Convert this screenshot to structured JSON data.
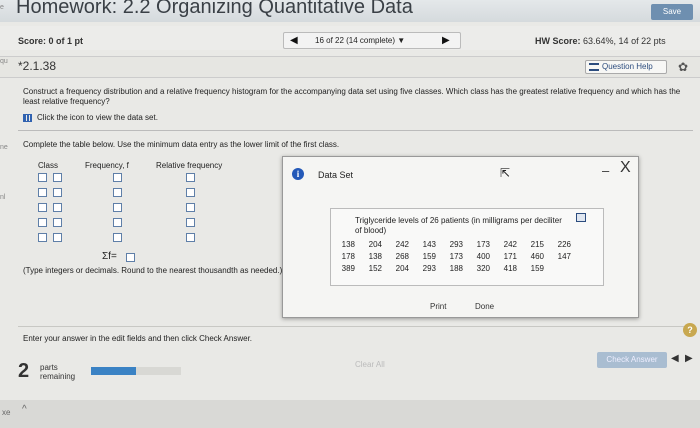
{
  "header": {
    "title": "Homework: 2.2 Organizing Quantitative Data",
    "save_label": "Save"
  },
  "score_bar": {
    "score": "Score: 0 of 1 pt",
    "nav_label": "16 of 22 (14 complete)",
    "hw_score_label": "HW Score:",
    "hw_score_value": "63.64%, 14 of 22 pts"
  },
  "question": {
    "number": "*2.1.38",
    "help_label": "Question Help",
    "instructions": "Construct a frequency distribution and a relative frequency histogram for the accompanying data set using five classes. Which class has the greatest relative frequency and which has the least relative frequency?",
    "data_link": "Click the icon to view the data set.",
    "complete_text": "Complete the table below. Use the minimum data entry as the lower limit of the first class.",
    "columns": [
      "Class",
      "Frequency, f",
      "Relative frequency"
    ],
    "sum_label": "Σf=",
    "type_note": "(Type integers or decimals. Round to the nearest thousandth as needed.)"
  },
  "modal": {
    "title": "Data Set",
    "caption": "Triglyceride levels of 26 patients (in milligrams per deciliter of blood)",
    "rows": [
      [
        "138",
        "204",
        "242",
        "143",
        "293",
        "173",
        "242",
        "215",
        "226"
      ],
      [
        "178",
        "138",
        "268",
        "159",
        "173",
        "400",
        "171",
        "460",
        "147"
      ],
      [
        "389",
        "152",
        "204",
        "293",
        "188",
        "320",
        "418",
        "159"
      ]
    ],
    "print_label": "Print",
    "done_label": "Done",
    "minimize_label": "–",
    "close_label": "X"
  },
  "footer": {
    "enter_text": "Enter your answer in the edit fields and then click Check Answer.",
    "parts_count": "2",
    "parts_label_1": "parts",
    "parts_label_2": "remaining",
    "progress_fraction": 0.5,
    "clear_all_label": "Clear All",
    "check_answer_label": "Check Answer",
    "help_label": "?",
    "bottom_label": "xe"
  },
  "side_labels": [
    "e",
    "qu",
    "ne",
    "nl"
  ]
}
